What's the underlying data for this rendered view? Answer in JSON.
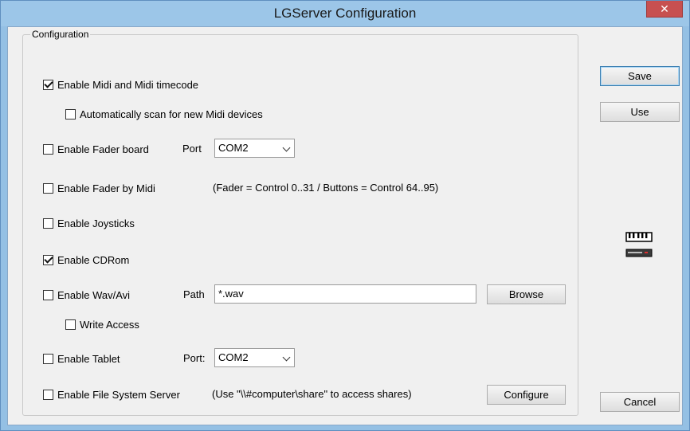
{
  "window": {
    "title": "LGServer Configuration",
    "close_glyph": "✕"
  },
  "group": {
    "label": "Configuration"
  },
  "options": {
    "midi": {
      "label": "Enable Midi and Midi timecode",
      "checked": true
    },
    "autoscan": {
      "label": "Automatically scan for new Midi devices",
      "checked": false
    },
    "fader_board": {
      "label": "Enable Fader board",
      "checked": false,
      "port_label": "Port",
      "port_value": "COM2"
    },
    "fader_midi": {
      "label": "Enable Fader by Midi",
      "checked": false,
      "note": "(Fader = Control 0..31  /  Buttons = Control 64..95)"
    },
    "joysticks": {
      "label": "Enable Joysticks",
      "checked": false
    },
    "cdrom": {
      "label": "Enable CDRom",
      "checked": true
    },
    "wav": {
      "label": "Enable Wav/Avi",
      "checked": false,
      "path_label": "Path",
      "path_value": "*.wav",
      "browse_label": "Browse"
    },
    "write_access": {
      "label": "Write Access",
      "checked": false
    },
    "tablet": {
      "label": "Enable Tablet",
      "checked": false,
      "port_label": "Port:",
      "port_value": "COM2"
    },
    "fs_server": {
      "label": "Enable File System Server",
      "checked": false,
      "note": "(Use \"\\\\#computer\\share\" to access shares)",
      "configure_label": "Configure"
    }
  },
  "buttons": {
    "save": "Save",
    "use": "Use",
    "cancel": "Cancel"
  },
  "icons": {
    "midi_device": "midi-keyboard-icon"
  }
}
